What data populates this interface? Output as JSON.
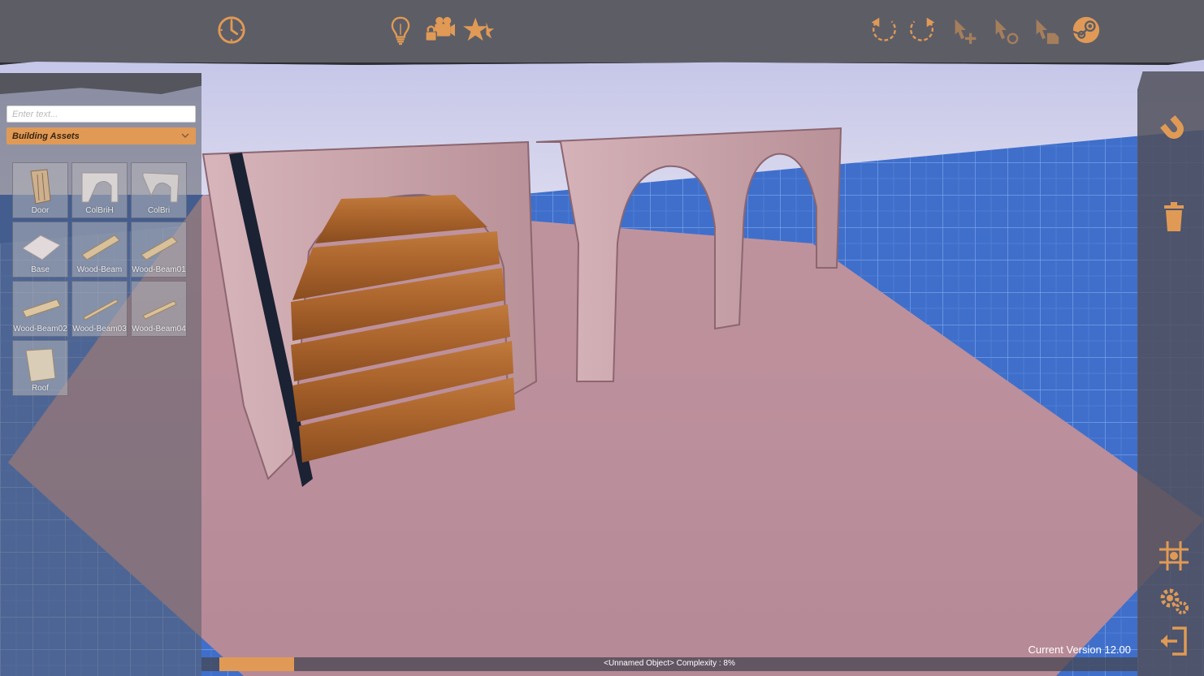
{
  "colors": {
    "accent": "#e09a55",
    "toolbar_bg": "#5d5d66",
    "grid_blue": "#2a5dbf"
  },
  "toolbar": {
    "buttons": [
      {
        "icon": "clock-icon"
      },
      {
        "icon": "lightbulb-icon"
      },
      {
        "icon": "lock-camera-icon"
      },
      {
        "icon": "star-icon"
      },
      {
        "icon": "undo-icon"
      },
      {
        "icon": "redo-icon"
      },
      {
        "icon": "add-object-icon"
      },
      {
        "icon": "duplicate-object-icon"
      },
      {
        "icon": "save-object-icon"
      },
      {
        "icon": "steam-icon"
      }
    ]
  },
  "left_panel": {
    "search": {
      "placeholder": "Enter text...",
      "value": ""
    },
    "category": {
      "selected": "Building Assets"
    },
    "assets": [
      {
        "name": "Door"
      },
      {
        "name": "ColBriH"
      },
      {
        "name": "ColBri"
      },
      {
        "name": "Base"
      },
      {
        "name": "Wood-Beam"
      },
      {
        "name": "Wood-Beam01"
      },
      {
        "name": "Wood-Beam02"
      },
      {
        "name": "Wood-Beam03"
      },
      {
        "name": "Wood-Beam04"
      },
      {
        "name": "Roof"
      }
    ]
  },
  "right_rail": {
    "buttons": [
      {
        "icon": "magnet-icon"
      },
      {
        "icon": "trash-icon"
      },
      {
        "icon": "grid-snap-icon"
      },
      {
        "icon": "settings-icon"
      },
      {
        "icon": "exit-icon"
      }
    ]
  },
  "status": {
    "object_info": "<Unnamed Object> Complexity : 8%",
    "complexity_percent": 8
  },
  "version": "Current Version 12.00"
}
